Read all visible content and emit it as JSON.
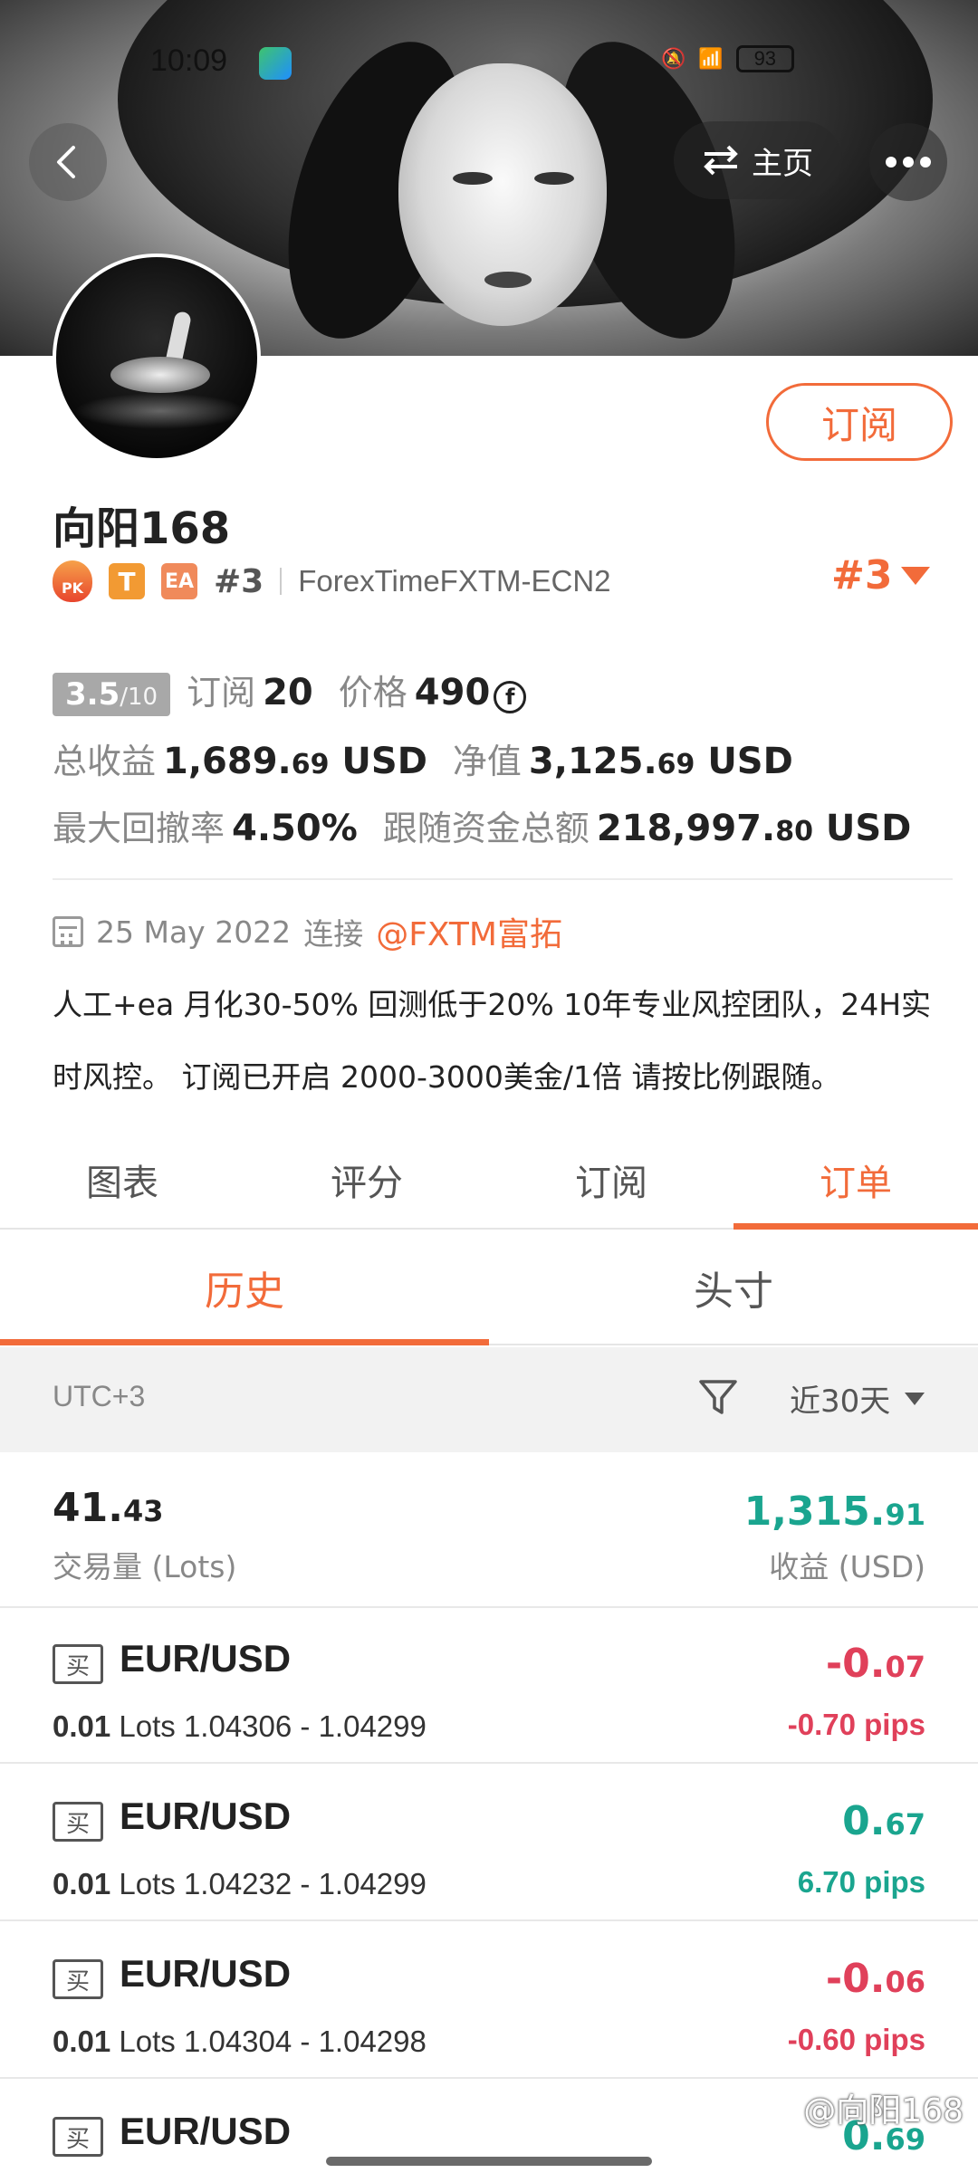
{
  "status_bar": {
    "time": "10:09",
    "battery": "93"
  },
  "header": {
    "home_label": "主页"
  },
  "profile": {
    "subscribe_label": "订阅",
    "username": "向阳168",
    "badges": {
      "pk": "PK",
      "t": "T",
      "ea": "EA"
    },
    "rank_small": "#3",
    "broker": "ForexTimeFXTM-ECN2",
    "rank_big": "#3"
  },
  "stats": {
    "score_main": "3.5",
    "score_denom": "/10",
    "subscribe_label": "订阅",
    "subscribe_count": "20",
    "price_label": "价格",
    "price_value": "490",
    "price_coin": "f",
    "total_profit_label": "总收益",
    "total_profit_int": "1,689.",
    "total_profit_dec": "69",
    "total_profit_unit": " USD",
    "equity_label": "净值",
    "equity_int": "3,125.",
    "equity_dec": "69",
    "equity_unit": " USD",
    "max_drawdown_label": "最大回撤率",
    "max_drawdown_value": "4.50%",
    "follow_funds_label": "跟随资金总额",
    "follow_funds_int": "218,997.",
    "follow_funds_dec": "80",
    "follow_funds_unit": " USD"
  },
  "connection": {
    "date": "25 May 2022",
    "connect_label": "连接",
    "broker_link": "@FXTM富拓"
  },
  "description": "人工+ea 月化30-50% 回测低于20% 10年专业风控团队，24H实时风控。 订阅已开启 2000-3000美金/1倍 请按比例跟随。",
  "tabs": [
    "图表",
    "评分",
    "订阅",
    "订单"
  ],
  "subtabs": [
    "历史",
    "头寸"
  ],
  "filter": {
    "timezone": "UTC+3",
    "period": "近30天"
  },
  "summary": {
    "volume_int": "41.",
    "volume_dec": "43",
    "volume_label": "交易量 (Lots)",
    "profit_int": "1,315.",
    "profit_dec": "91",
    "profit_label": "收益 (USD)"
  },
  "orders": [
    {
      "side": "买",
      "pair": "EUR/USD",
      "lots": "0.01",
      "lots_label": " Lots ",
      "prices": "1.04306 - 1.04299",
      "pl_int": "-0.",
      "pl_dec": "07",
      "pips": "-0.70 pips"
    },
    {
      "side": "买",
      "pair": "EUR/USD",
      "lots": "0.01",
      "lots_label": " Lots ",
      "prices": "1.04232 - 1.04299",
      "pl_int": "0.",
      "pl_dec": "67",
      "pips": "6.70 pips"
    },
    {
      "side": "买",
      "pair": "EUR/USD",
      "lots": "0.01",
      "lots_label": " Lots ",
      "prices": "1.04304 - 1.04298",
      "pl_int": "-0.",
      "pl_dec": "06",
      "pips": "-0.60 pips"
    },
    {
      "side": "买",
      "pair": "EUR/USD",
      "pl_int": "0.",
      "pl_dec": "69"
    }
  ],
  "watermark": "@向阳168",
  "colors": {
    "accent": "#f26b3a",
    "positive": "#1aa58f",
    "negative": "#e0405a"
  }
}
